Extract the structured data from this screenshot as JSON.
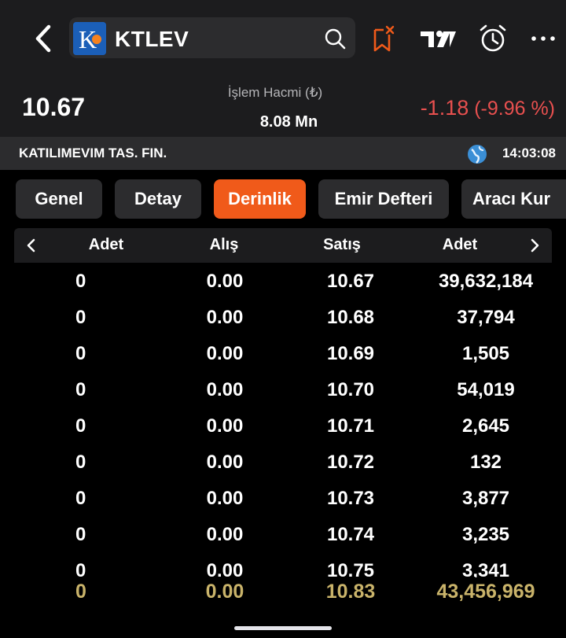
{
  "header": {
    "ticker": "KTLEV",
    "logo_letter": "K",
    "icons": [
      "back-chevron-icon",
      "search-icon",
      "bookmark-remove-icon",
      "tradingview-icon",
      "alarm-clock-icon",
      "more-icon"
    ]
  },
  "price_bar": {
    "price": "10.67",
    "volume_label": "İşlem Hacmi (₺)",
    "volume_value": "8.08 Mn",
    "change_abs": "-1.18",
    "change_pct": "(-9.96 %)"
  },
  "info_bar": {
    "company": "KATILIMEVIM TAS. FIN.",
    "time": "14:03:08"
  },
  "tabs": [
    {
      "label": "Genel"
    },
    {
      "label": "Detay"
    },
    {
      "label": "Derinlik"
    },
    {
      "label": "Emir Defteri"
    },
    {
      "label": "Aracı Kur"
    }
  ],
  "depth_table": {
    "columns": [
      "Adet",
      "Alış",
      "Satış",
      "Adet"
    ],
    "rows": [
      [
        "0",
        "0.00",
        "10.67",
        "39,632,184"
      ],
      [
        "0",
        "0.00",
        "10.68",
        "37,794"
      ],
      [
        "0",
        "0.00",
        "10.69",
        "1,505"
      ],
      [
        "0",
        "0.00",
        "10.70",
        "54,019"
      ],
      [
        "0",
        "0.00",
        "10.71",
        "2,645"
      ],
      [
        "0",
        "0.00",
        "10.72",
        "132"
      ],
      [
        "0",
        "0.00",
        "10.73",
        "3,877"
      ],
      [
        "0",
        "0.00",
        "10.74",
        "3,235"
      ],
      [
        "0",
        "0.00",
        "10.75",
        "3,341"
      ]
    ],
    "totals": [
      "0",
      "0.00",
      "10.83",
      "43,456,969"
    ]
  },
  "colors": {
    "accent": "#f05a1a",
    "negative": "#e8504f",
    "totals": "#c9b36a",
    "panel": "#1c1c1e",
    "tab_bg": "#2c2c2e"
  }
}
